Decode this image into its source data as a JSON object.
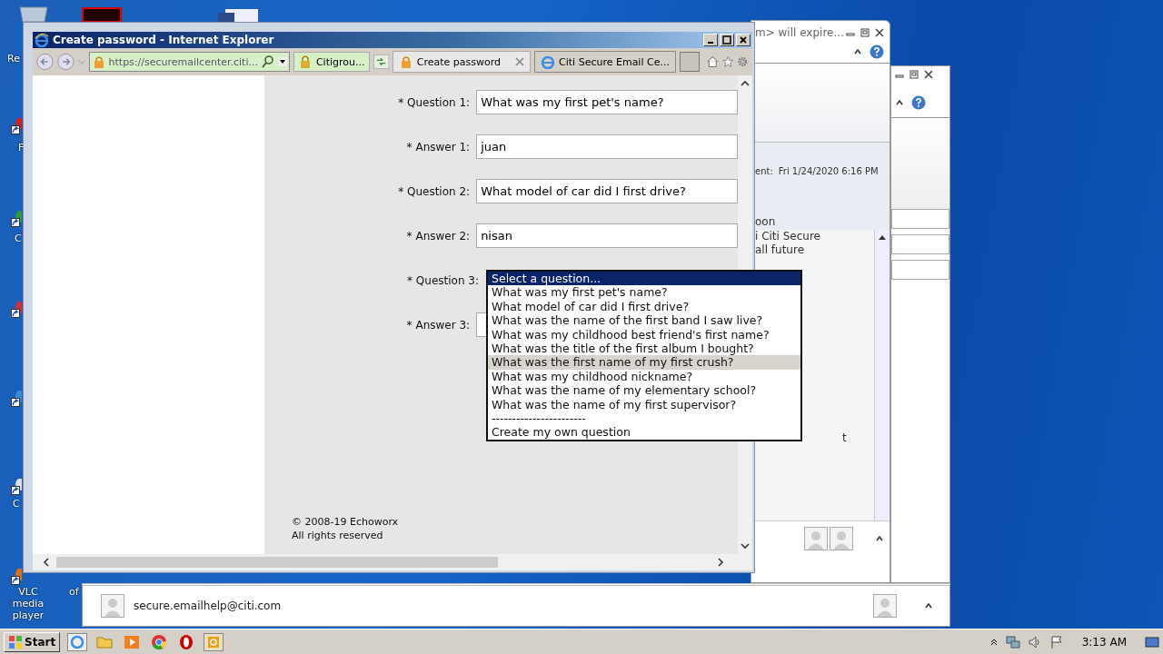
{
  "desktop": {
    "labels": [
      {
        "text": "Re"
      },
      {
        "text": "F"
      },
      {
        "text": "C"
      },
      {
        "text": "C"
      },
      {
        "text": "VLC media player"
      },
      {
        "text": "of"
      }
    ]
  },
  "back_window": {
    "title": "m> will expire...",
    "sent_label": "ent:",
    "sent_value": "Fri 1/24/2020 6:16 PM",
    "header_line": "oon",
    "body_lines": [
      "i Citi Secure",
      "all future"
    ],
    "tail": "t"
  },
  "bottom_window": {
    "sender": "secure.emailhelp@citi.com"
  },
  "browser": {
    "title": "Create password - Internet Explorer",
    "address": "https://securemailcenter.citi...",
    "site_badge": "Citigrou...",
    "tabs": [
      {
        "label": "Create password",
        "selected": true
      },
      {
        "label": "Citi Secure Email Ce...",
        "selected": false
      }
    ],
    "form": [
      {
        "label": "* Question 1:",
        "kind": "select",
        "value": "What was my first pet's name?"
      },
      {
        "label": "* Answer 1:",
        "kind": "text",
        "value": "juan"
      },
      {
        "label": "* Question 2:",
        "kind": "select",
        "value": "What model of car did I first drive?"
      },
      {
        "label": "* Answer 2:",
        "kind": "text",
        "value": "nisan"
      },
      {
        "label": "* Question 3:",
        "kind": "open-select"
      },
      {
        "label": "* Answer 3:",
        "kind": "text"
      }
    ],
    "dropdown": [
      {
        "label": "Select a question...",
        "selected": true,
        "hovered": false
      },
      {
        "label": "What was my first pet's name?",
        "selected": false,
        "hovered": false
      },
      {
        "label": "What model of car did I first drive?",
        "selected": false,
        "hovered": false
      },
      {
        "label": "What was the name of the first band I saw live?",
        "selected": false,
        "hovered": false
      },
      {
        "label": "What was my childhood best friend's first name?",
        "selected": false,
        "hovered": false
      },
      {
        "label": "What was the title of the first album I bought?",
        "selected": false,
        "hovered": false
      },
      {
        "label": "What was the first name of my first crush?",
        "selected": false,
        "hovered": true
      },
      {
        "label": "What was my childhood nickname?",
        "selected": false,
        "hovered": false
      },
      {
        "label": "What was the name of my elementary school?",
        "selected": false,
        "hovered": false
      },
      {
        "label": "What was the name of my first supervisor?",
        "selected": false,
        "hovered": false
      },
      {
        "label": "-----------------------",
        "selected": false,
        "hovered": false
      },
      {
        "label": "Create my own question",
        "selected": false,
        "hovered": false
      }
    ],
    "footer": [
      "© 2008-19 Echoworx",
      "All rights reserved"
    ]
  },
  "taskbar": {
    "start": "Start",
    "clock": "3:13 AM"
  }
}
